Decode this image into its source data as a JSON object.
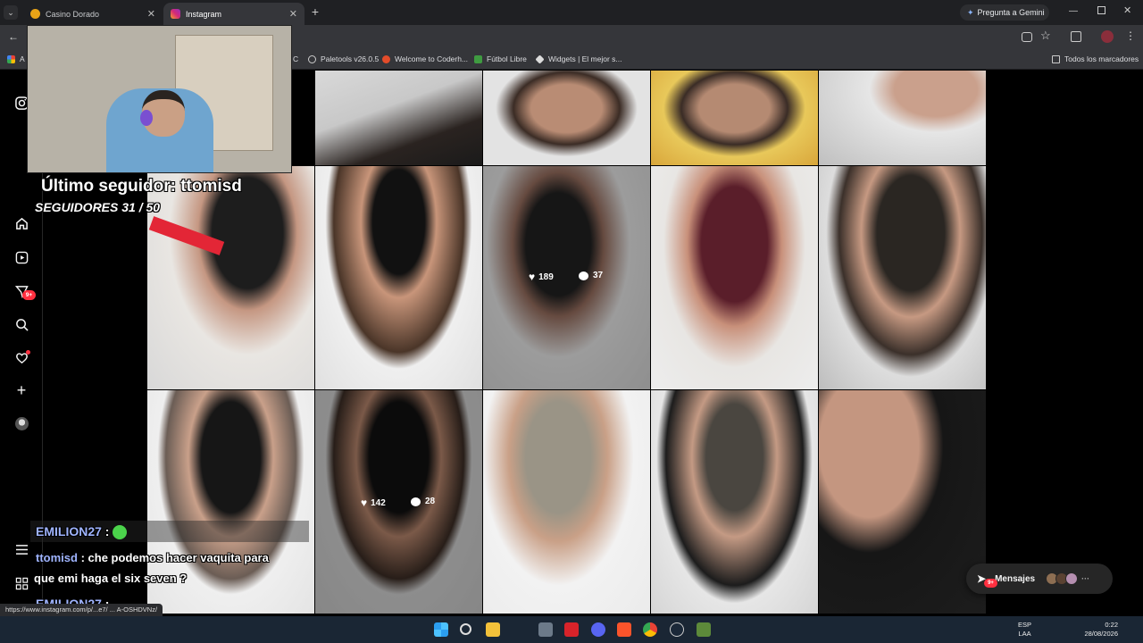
{
  "browser": {
    "tabs": [
      {
        "title": "Casino Dorado",
        "active": false
      },
      {
        "title": "Instagram",
        "active": true
      }
    ],
    "new_tab_icon": "plus-icon",
    "gemini_label": "Pregunta a Gemini",
    "bookmarks": [
      {
        "label": "Paletools v26.0.5"
      },
      {
        "label": "Welcome to Coderh..."
      },
      {
        "label": "Fútbol Libre"
      },
      {
        "label": "Widgets | El mejor s..."
      }
    ],
    "bookmarks_all": "Todos los marcadores",
    "bookmark_partial_left": "A",
    "bookmark_partial_c": "C",
    "status_url": "https://www.instagram.com/p/...e7/ ... A-OSHDVNz/"
  },
  "stream": {
    "last_follower": "Último seguidor: ttomisd",
    "followers": "SEGUIDORES 31 / 50",
    "chat": [
      {
        "name": "EMILION27",
        "sep": ":",
        "text": ""
      },
      {
        "name": "ttomisd",
        "sep": ":",
        "text": "che podemos hacer vaquita para"
      },
      {
        "name": "",
        "sep": "",
        "text": "que emi haga el six seven ?"
      },
      {
        "name": "EMILION27",
        "sep": ":",
        "text": ""
      }
    ]
  },
  "posts": {
    "hover_top": {
      "likes": "189",
      "comments": "37"
    },
    "hover_bottom": {
      "likes": "142",
      "comments": "28"
    }
  },
  "messages": {
    "label": "Mensajes",
    "badge": "9+"
  },
  "sidebar": {
    "notif_badge": "9+"
  },
  "taskbar": {
    "lang_top": "ESP",
    "lang_bottom": "LAA",
    "time": "0:22",
    "date": "28/08/2026"
  },
  "colors": {
    "accent_red": "#ff3040",
    "browser_dark": "#1f2023",
    "toolbar": "#35363a",
    "taskbar": "#1a2634"
  }
}
